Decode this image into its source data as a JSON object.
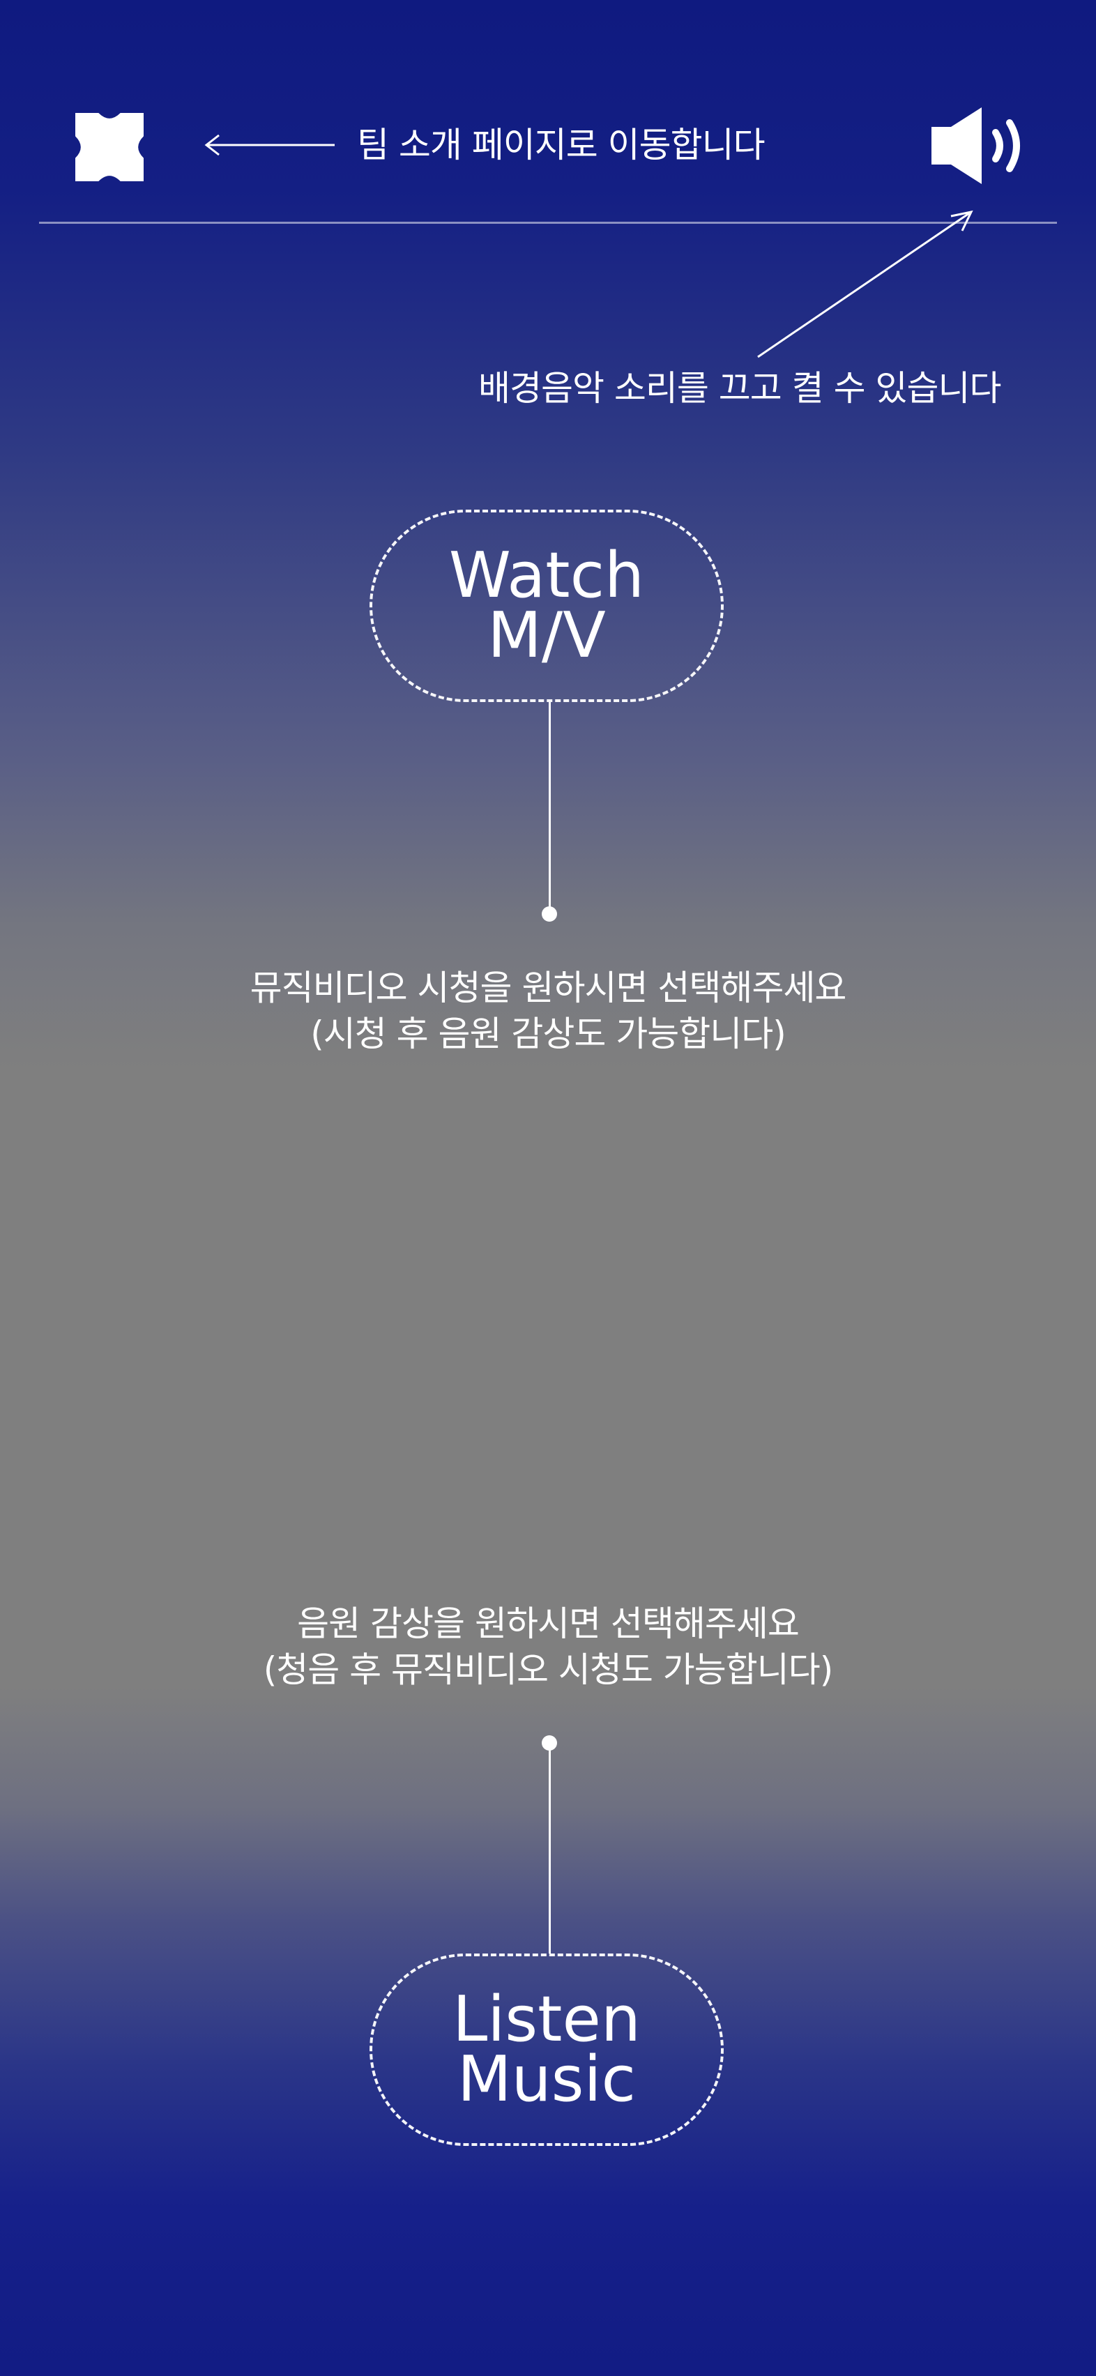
{
  "header": {
    "logo_icon": "cross-emblem-icon",
    "team_hint": "팀 소개 페이지로 이동합니다",
    "sound_icon": "speaker-volume-icon",
    "sound_hint": "배경음악 소리를 끄고 켤 수 있습니다"
  },
  "watch": {
    "label": "Watch\nM/V",
    "caption_line1": "뮤직비디오 시청을 원하시면 선택해주세요",
    "caption_line2": "(시청 후 음원 감상도 가능합니다)"
  },
  "listen": {
    "label": "Listen\nMusic",
    "caption_line1": "음원 감상을 원하시면 선택해주세요",
    "caption_line2": "(청음 후 뮤직비디오 시청도 가능합니다)"
  },
  "colors": {
    "top_background": "#0f1a80",
    "middle_background": "#7f7f7f",
    "foreground": "#ffffff"
  }
}
